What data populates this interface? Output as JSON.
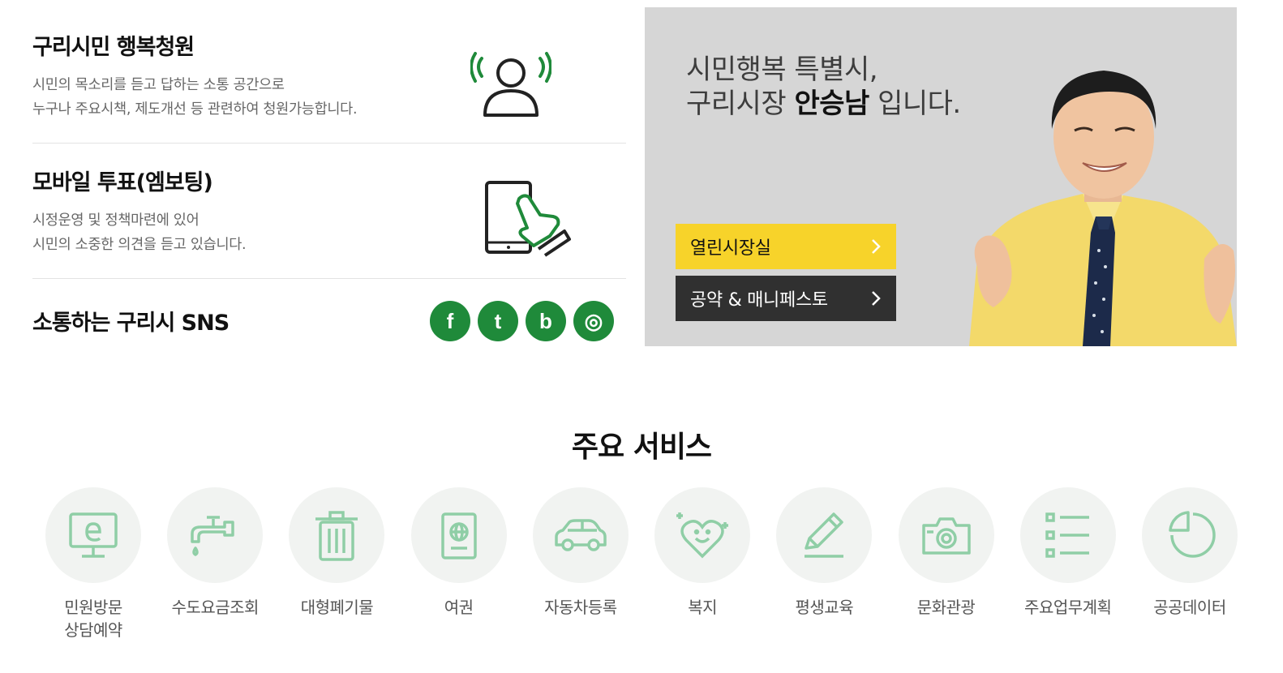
{
  "petition": {
    "title": "구리시민 행복청원",
    "desc_line1": "시민의 목소리를 듣고 답하는 소통 공간으로",
    "desc_line2": "누구나 주요시책, 제도개선 등 관련하여 청원가능합니다.",
    "icon": "person-broadcast-icon"
  },
  "mvoting": {
    "title": "모바일 투표(엠보팅)",
    "desc_line1": "시정운영 및 정책마련에 있어",
    "desc_line2": "시민의 소중한 의견을 듣고 있습니다.",
    "icon": "tablet-touch-icon"
  },
  "sns": {
    "title": "소통하는 구리시 SNS",
    "buttons": [
      {
        "glyph": "f",
        "icon": "facebook-icon"
      },
      {
        "glyph": "t",
        "icon": "twitter-icon"
      },
      {
        "glyph": "b",
        "icon": "blog-icon"
      },
      {
        "glyph": "◎",
        "icon": "instagram-icon"
      }
    ],
    "color": "#1f8a3a"
  },
  "mayor_banner": {
    "line1": "시민행복 특별시,",
    "line2_prefix": "구리시장 ",
    "line2_name": "안승남",
    "line2_suffix": " 입니다.",
    "btn_open": "열린시장실",
    "btn_pledge": "공약 & 매니페스토",
    "accent_yellow": "#f7d32a",
    "dark": "#303030"
  },
  "services": {
    "title": "주요 서비스",
    "icon_color": "#8fcea6",
    "items": [
      {
        "label": "민원방문\n상담예약",
        "icon": "e-monitor-icon"
      },
      {
        "label": "수도요금조회",
        "icon": "faucet-icon"
      },
      {
        "label": "대형폐기물",
        "icon": "trash-can-icon"
      },
      {
        "label": "여권",
        "icon": "passport-icon"
      },
      {
        "label": "자동차등록",
        "icon": "car-icon"
      },
      {
        "label": "복지",
        "icon": "heart-smile-icon"
      },
      {
        "label": "평생교육",
        "icon": "pencil-icon"
      },
      {
        "label": "문화관광",
        "icon": "camera-icon"
      },
      {
        "label": "주요업무계획",
        "icon": "list-icon"
      },
      {
        "label": "공공데이터",
        "icon": "pie-chart-icon"
      }
    ]
  }
}
